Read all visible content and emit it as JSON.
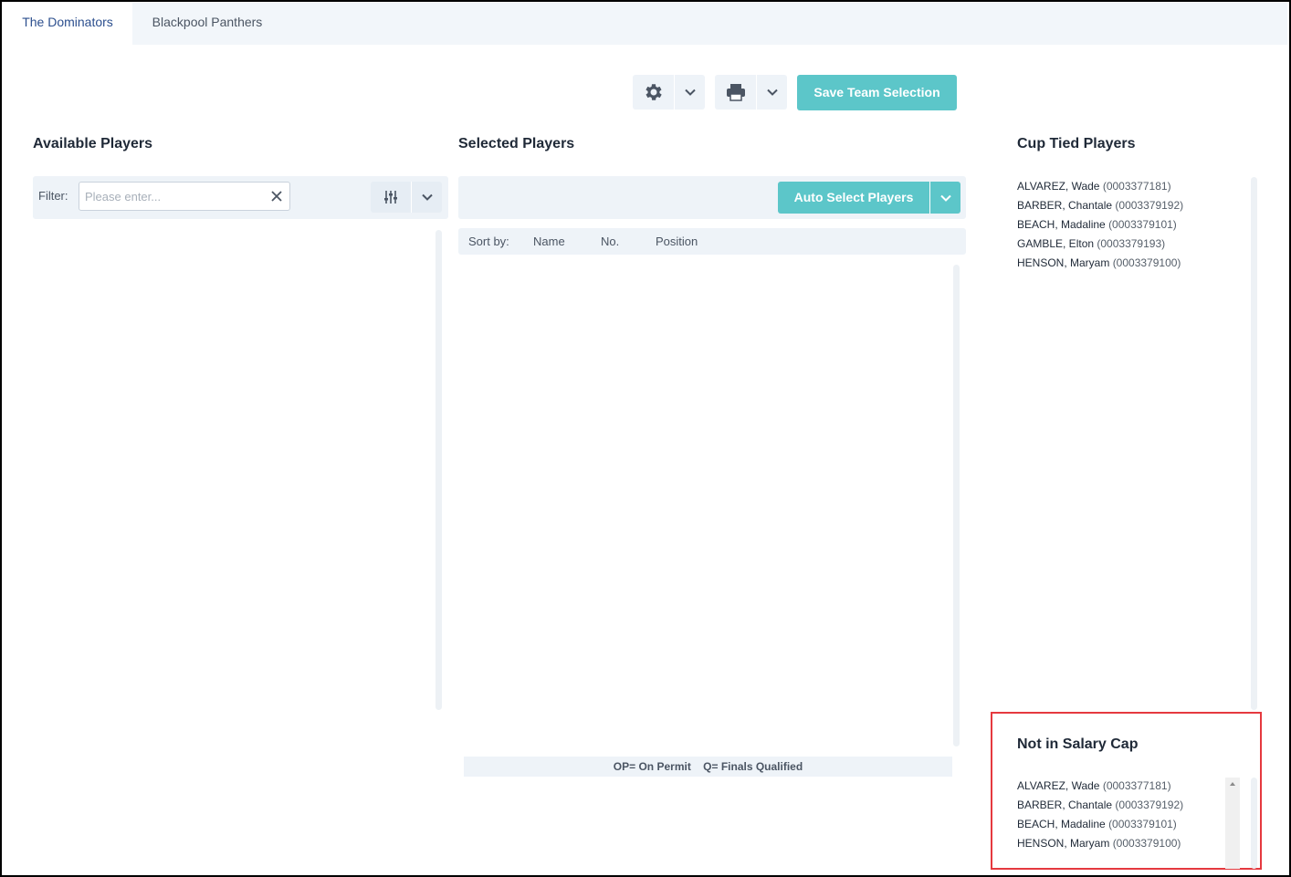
{
  "tabs": [
    {
      "label": "The Dominators",
      "active": true
    },
    {
      "label": "Blackpool Panthers",
      "active": false
    }
  ],
  "toolbar": {
    "settings_icon": "gear-icon",
    "print_icon": "printer-icon",
    "save_label": "Save Team Selection"
  },
  "available": {
    "title": "Available Players",
    "filter_label": "Filter:",
    "filter_placeholder": "Please enter..."
  },
  "selected": {
    "title": "Selected Players",
    "auto_select_label": "Auto Select Players",
    "sort_label": "Sort by:",
    "sort_columns": [
      "Name",
      "No.",
      "Position"
    ],
    "legend": "OP= On Permit    Q= Finals Qualified"
  },
  "cup_tied": {
    "title": "Cup Tied Players",
    "players": [
      {
        "name": "ALVAREZ, Wade",
        "id": "(0003377181)"
      },
      {
        "name": "BARBER, Chantale",
        "id": "(0003379192)"
      },
      {
        "name": "BEACH, Madaline",
        "id": "(0003379101)"
      },
      {
        "name": "GAMBLE, Elton",
        "id": "(0003379193)"
      },
      {
        "name": "HENSON, Maryam",
        "id": "(0003379100)"
      }
    ]
  },
  "salary_cap": {
    "title": "Not in Salary Cap",
    "players": [
      {
        "name": "ALVAREZ, Wade",
        "id": "(0003377181)"
      },
      {
        "name": "BARBER, Chantale",
        "id": "(0003379192)"
      },
      {
        "name": "BEACH, Madaline",
        "id": "(0003379101)"
      },
      {
        "name": "HENSON, Maryam",
        "id": "(0003379100)"
      }
    ]
  },
  "colors": {
    "accent": "#5cc6c9",
    "active_tab_text": "#2c4f8e",
    "panel_bg": "#eef3f8",
    "highlight": "#e5393f"
  }
}
